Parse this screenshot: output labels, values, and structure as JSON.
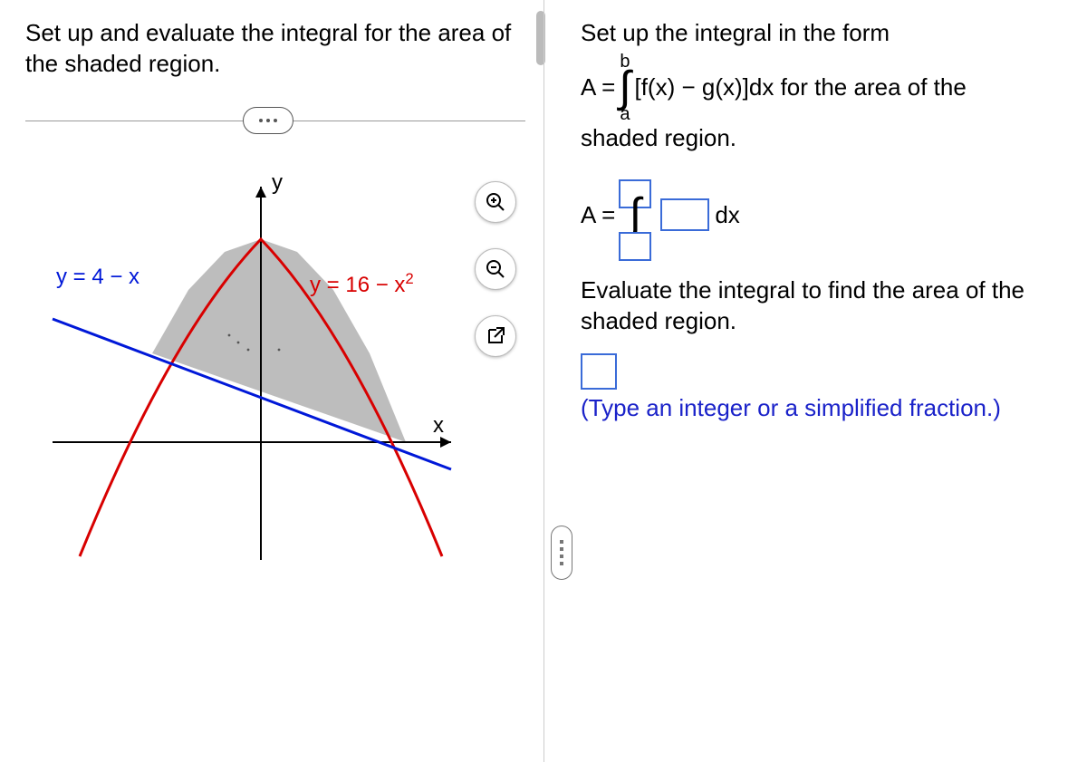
{
  "left": {
    "question": "Set up and evaluate the integral for the area of the shaded region.",
    "graph": {
      "line_label": "y = 4 − x",
      "curve_label_prefix": "y = 16 − x",
      "curve_exp": "2",
      "x_axis": "x",
      "y_axis": "y"
    }
  },
  "right": {
    "intro": "Set up the integral in the form",
    "formula_upper": "b",
    "formula_lower": "a",
    "formula_lhs": "A = ",
    "formula_body": "[f(x) − g(x)]dx for the area of the",
    "formula_tail": "shaded region.",
    "answer_lhs": "A = ",
    "answer_dx": "dx",
    "evaluate_text": "Evaluate the integral to find the area of the shaded region.",
    "hint": "(Type an integer or a simplified fraction.)"
  },
  "chart_data": {
    "type": "line",
    "title": "",
    "xlabel": "x",
    "ylabel": "y",
    "series": [
      {
        "name": "y = 4 − x",
        "color": "#0018d8",
        "x": [
          -5,
          5
        ],
        "y": [
          9,
          -1
        ]
      },
      {
        "name": "y = 16 − x^2",
        "color": "#d80000",
        "x": [
          -5,
          -4,
          -3,
          -2,
          -1,
          0,
          1,
          2,
          3,
          4,
          5
        ],
        "y": [
          -9,
          0,
          7,
          12,
          15,
          16,
          15,
          12,
          7,
          0,
          -9
        ]
      }
    ],
    "shaded_region": {
      "between": [
        "y = 16 − x^2",
        "y = 4 − x"
      ],
      "x_range": [
        -3,
        4
      ]
    },
    "xlim": [
      -5,
      5
    ],
    "ylim": [
      -10,
      18
    ]
  }
}
